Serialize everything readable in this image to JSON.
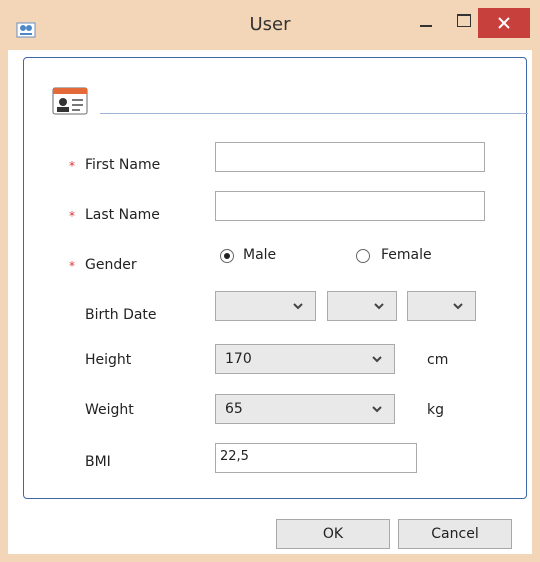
{
  "window": {
    "title": "User",
    "icons": {
      "app": "app-icon",
      "minimize": "minimize-icon",
      "maximize": "maximize-icon",
      "close": "close-icon"
    },
    "close_color": "#c8403b"
  },
  "form": {
    "first_name": {
      "label": "First Name",
      "required_mark": "*",
      "value": ""
    },
    "last_name": {
      "label": "Last Name",
      "required_mark": "*",
      "value": ""
    },
    "gender": {
      "label": "Gender",
      "required_mark": "*",
      "options": [
        "Male",
        "Female"
      ],
      "selected": "Male"
    },
    "birth_date": {
      "label": "Birth Date",
      "day": "",
      "month": "",
      "year": ""
    },
    "height": {
      "label": "Height",
      "value": "170",
      "unit": "cm"
    },
    "weight": {
      "label": "Weight",
      "value": "65",
      "unit": "kg"
    },
    "bmi": {
      "label": "BMI",
      "value": "22,5"
    }
  },
  "buttons": {
    "ok": "OK",
    "cancel": "Cancel"
  }
}
